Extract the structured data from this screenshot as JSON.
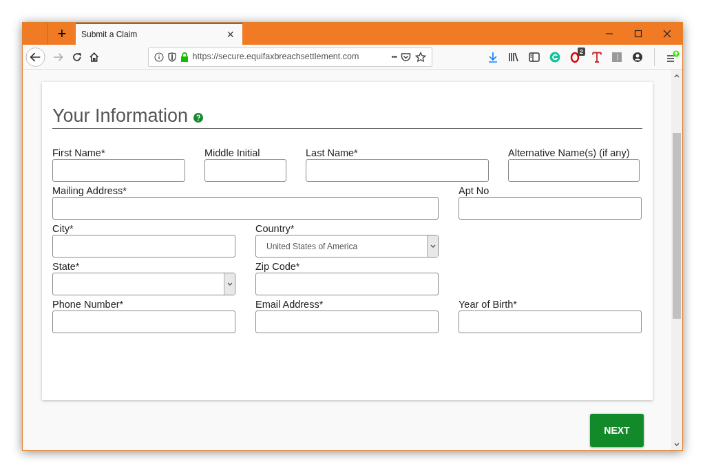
{
  "tab": {
    "title": "Submit a Claim",
    "close": "×",
    "new_tab": "+"
  },
  "address_bar": {
    "url": "https://secure.equifaxbreachsettlement.com",
    "more": "•••"
  },
  "toolbar": {
    "badge": "2"
  },
  "form": {
    "heading": "Your Information",
    "rows": [
      [
        {
          "label": "First Name*",
          "kind": "text"
        },
        {
          "label": "Middle Initial",
          "kind": "text"
        },
        {
          "label": "Last Name*",
          "kind": "text"
        },
        {
          "label": "Alternative Name(s) (if any)",
          "kind": "text"
        }
      ],
      [
        {
          "label": "Mailing Address*",
          "kind": "text"
        },
        {
          "label": "Apt No",
          "kind": "text"
        }
      ],
      [
        {
          "label": "City*",
          "kind": "text"
        },
        {
          "label": "Country*",
          "kind": "select",
          "value": "United States of America"
        }
      ],
      [
        {
          "label": "State*",
          "kind": "select"
        },
        {
          "label": "Zip Code*",
          "kind": "text"
        }
      ],
      [
        {
          "label": "Phone Number*",
          "kind": "text"
        },
        {
          "label": "Email Address*",
          "kind": "text"
        },
        {
          "label": "Year of Birth*",
          "kind": "text"
        }
      ]
    ]
  },
  "next_button": "NEXT"
}
